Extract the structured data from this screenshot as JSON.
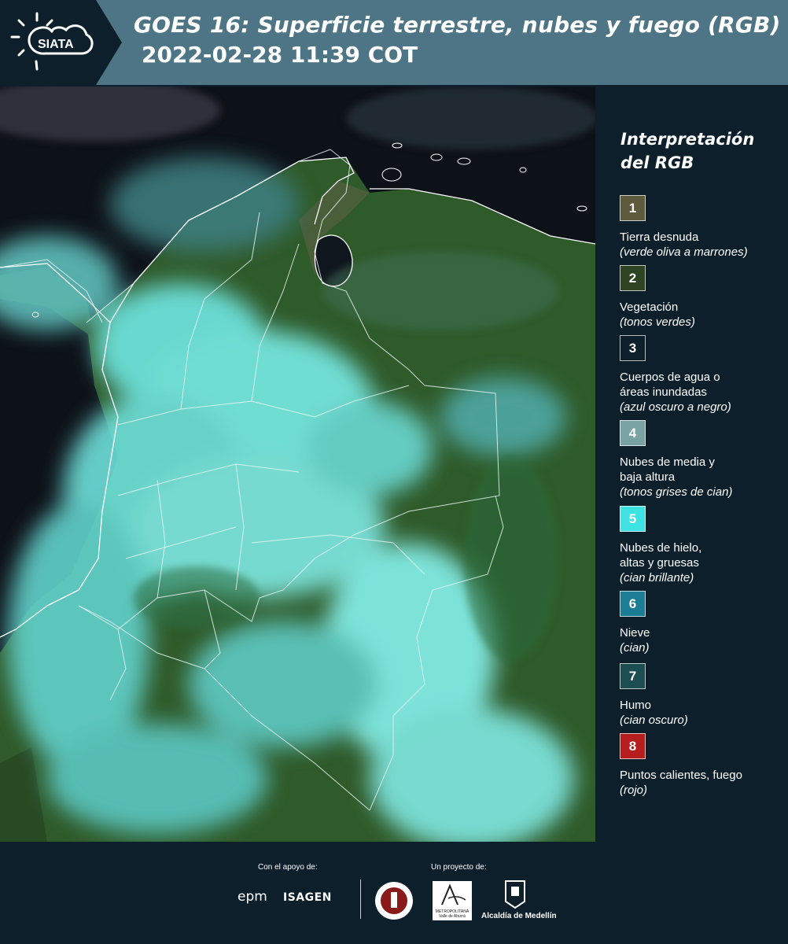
{
  "header": {
    "logo_text": "SIATA",
    "title": "GOES 16: Superficie terrestre, nubes y fuego (RGB)",
    "datetime": "2022-02-28 11:39 COT"
  },
  "legend": {
    "title": "Interpretación del RGB",
    "items": [
      {
        "number": "1",
        "color": "#5e5a3e",
        "label": "Tierra desnuda",
        "description": "(verde oliva a marrones)"
      },
      {
        "number": "2",
        "color": "#2d4321",
        "label": "Vegetación",
        "description": "(tonos verdes)"
      },
      {
        "number": "3",
        "color": "#0c1f2b",
        "label": "Cuerpos de agua o áreas inundadas",
        "description": "(azul oscuro a negro)"
      },
      {
        "number": "4",
        "color": "#79a2a3",
        "label": "Nubes de media y baja altura",
        "description": "(tonos grises de cian)"
      },
      {
        "number": "5",
        "color": "#3fe2e2",
        "label": "Nubes de hielo, altas y gruesas",
        "description": "(cian brillante)"
      },
      {
        "number": "6",
        "color": "#1d7d96",
        "label": "Nieve",
        "description": "(cian)"
      },
      {
        "number": "7",
        "color": "#1c4d51",
        "label": "Humo",
        "description": "(cian oscuro)"
      },
      {
        "number": "8",
        "color": "#b61d1d",
        "label": "Puntos calientes, fuego",
        "description": "(rojo)"
      }
    ]
  },
  "footer": {
    "support_label": "Con el apoyo de:",
    "project_label": "Un proyecto de:",
    "sponsors": [
      "epm",
      "ISAGEN"
    ],
    "area_logo_text": "METROPOLITANA Valle de Aburrá",
    "alcaldia": "Alcaldía de Medellín"
  },
  "colors": {
    "header_bg": "#4d7585",
    "panel_bg": "#0c1f2b",
    "vegetation": "#2f5a2a",
    "cloud": "#5fe0dc",
    "water": "#0d1118"
  }
}
